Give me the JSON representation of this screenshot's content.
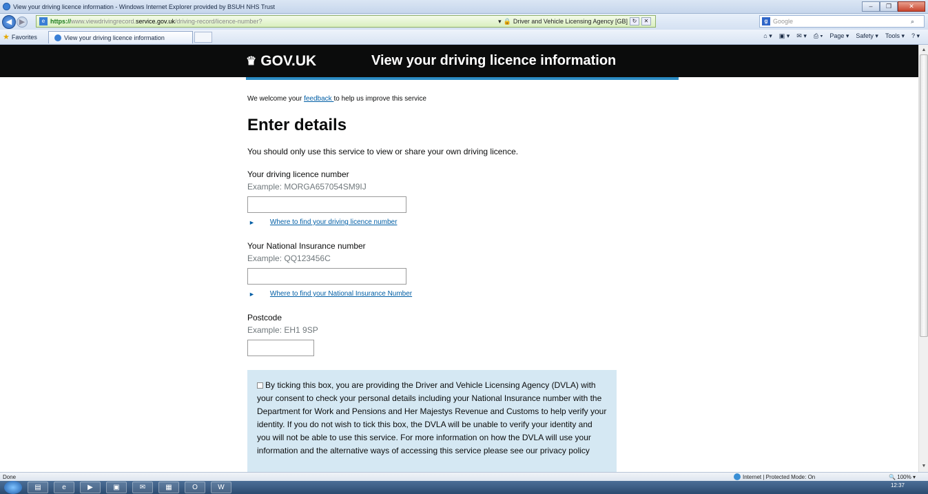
{
  "window": {
    "title": "View your driving licence information - Windows Internet Explorer provided by BSUH NHS Trust"
  },
  "address_bar": {
    "scheme": "https://",
    "prefix": "www.viewdrivingrecord.",
    "host": "service.gov.uk",
    "path": "/driving-record/licence-number?",
    "cert_label": "Driver and Vehicle Licensing Agency [GB]"
  },
  "search": {
    "placeholder": "Google"
  },
  "favorites": {
    "label": "Favorites"
  },
  "tab": {
    "label": "View your driving licence information"
  },
  "command_bar": {
    "page": "Page ▾",
    "safety": "Safety ▾",
    "tools": "Tools ▾"
  },
  "header": {
    "logo": "GOV.UK",
    "service_name": "View your driving licence information"
  },
  "feedback": {
    "before": "We welcome your ",
    "link": "feedback ",
    "after": "to help us improve this service"
  },
  "heading": "Enter details",
  "intro": "You should only use this service to view or share your own driving licence.",
  "fields": {
    "licence": {
      "label": "Your driving licence number",
      "hint": "Example: MORGA657054SM9IJ",
      "value": "",
      "help_link": "Where to find your driving licence number"
    },
    "ni": {
      "label": "Your National Insurance number",
      "hint": "Example: QQ123456C",
      "value": "",
      "help_link": "Where to find your National Insurance Number"
    },
    "postcode": {
      "label": "Postcode",
      "hint": "Example: EH1 9SP",
      "value": ""
    }
  },
  "consent": {
    "checked": false,
    "text": "By ticking this box, you are providing the Driver and Vehicle Licensing Agency (DVLA) with your consent to check your personal details including your National Insurance number with the Department for Work and Pensions and Her Majestys Revenue and Customs to help verify your identity. If you do not wish to tick this box, the DVLA will be unable to verify your identity and you will not be able to use this service. For more information on how the DVLA will use your information and the alternative ways of accessing this service please see our privacy policy"
  },
  "status_bar": {
    "left": "Done",
    "zone": "Internet | Protected Mode: On",
    "zoom": "100%"
  },
  "taskbar": {
    "time": "12:37"
  }
}
